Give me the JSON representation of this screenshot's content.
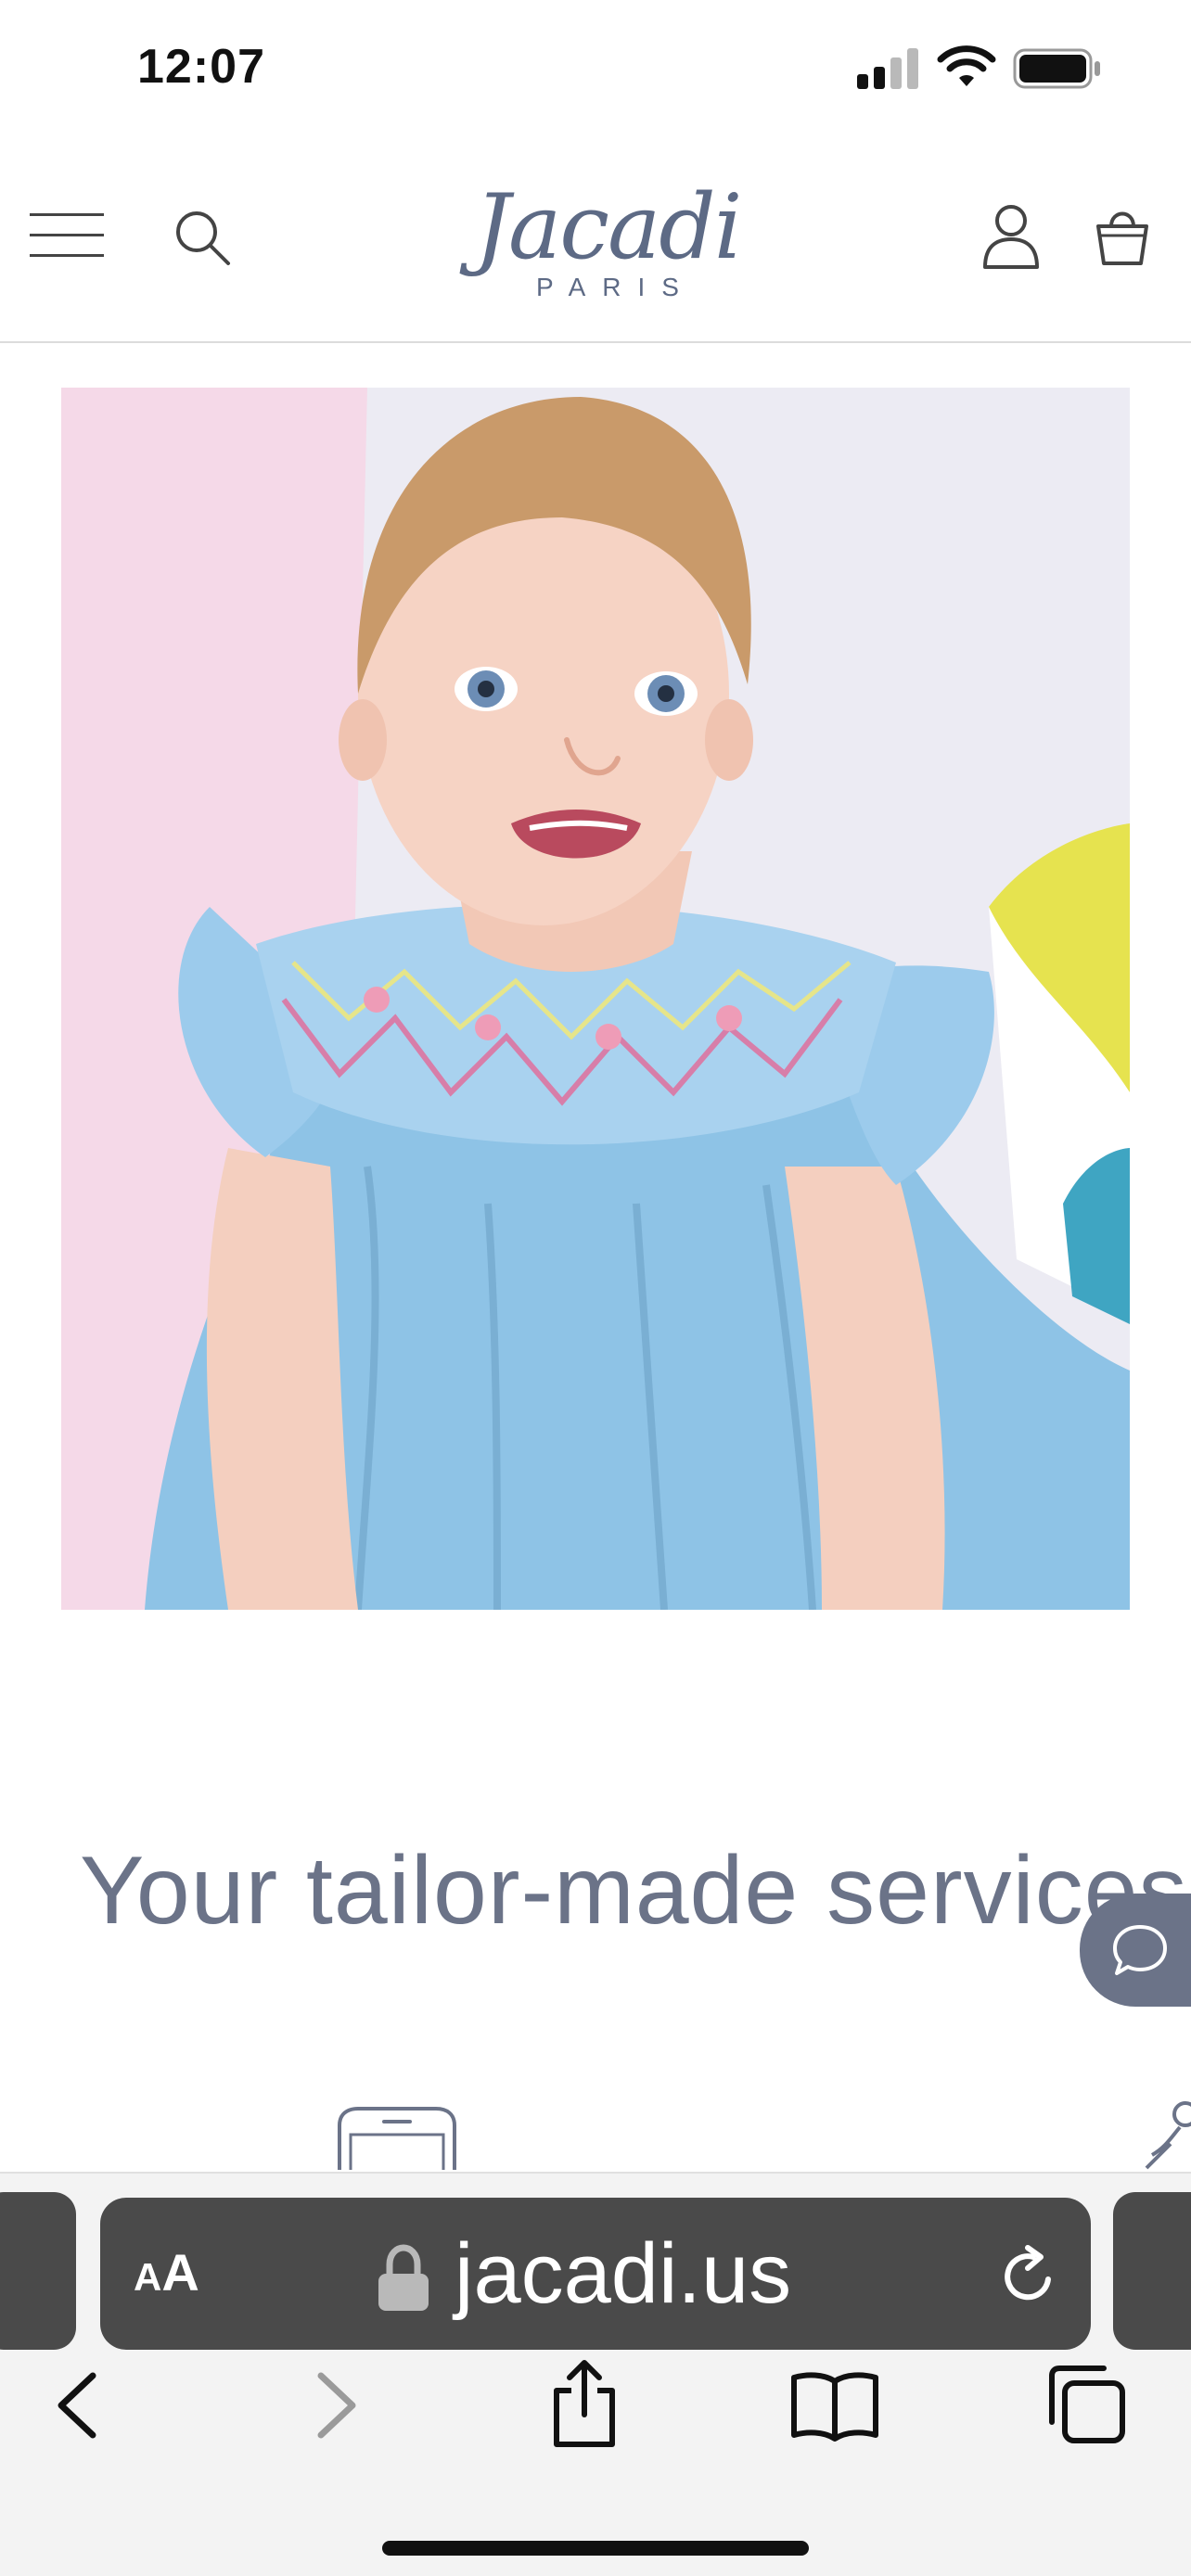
{
  "status_bar": {
    "time": "12:07",
    "icons": [
      "cellular-signal-icon",
      "wifi-icon",
      "battery-icon"
    ]
  },
  "header": {
    "menu_icon": "hamburger-menu-icon",
    "search_icon": "search-icon",
    "logo_text": "Jacadi",
    "logo_subtext": "PARIS",
    "account_icon": "user-account-icon",
    "bag_icon": "shopping-bag-icon"
  },
  "hero": {
    "image": "hero-baby-photo"
  },
  "services": {
    "title": "Your tailor-made services",
    "chat_icon": "chat-bubble-icon",
    "service_icons": [
      "phone-icon",
      "partial-service-icon"
    ]
  },
  "browser": {
    "text_size_button": {
      "small": "A",
      "big": "A"
    },
    "url": "jacadi.us",
    "icons": [
      "lock-icon",
      "reload-icon",
      "back-icon",
      "forward-icon",
      "share-icon",
      "bookmarks-icon",
      "tabs-icon"
    ]
  },
  "colors": {
    "brand_slate": "#6b7388",
    "logo_blue": "#5d6a85",
    "safari_pill": "#4a4a4a"
  }
}
